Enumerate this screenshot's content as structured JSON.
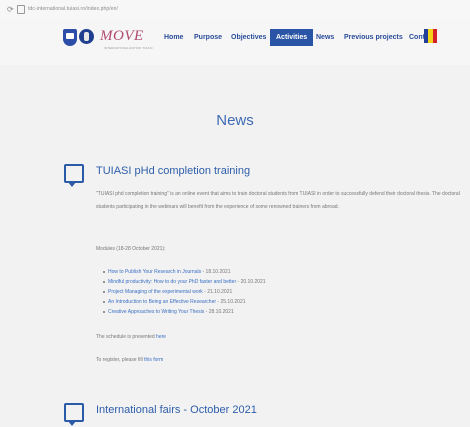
{
  "browser": {
    "url": "tdc-international.tuiasi.ro/index.php/en/"
  },
  "header": {
    "brand": "MOVE",
    "brand_sub": "INTERNATIONALIZATION TUIASI",
    "menu": [
      {
        "label": "Home",
        "active": false
      },
      {
        "label": "Purpose",
        "active": false
      },
      {
        "label": "Objectives",
        "active": false
      },
      {
        "label": "Activities",
        "active": true
      },
      {
        "label": "News",
        "active": false
      },
      {
        "label": "Previous projects",
        "active": false
      },
      {
        "label": "Contact",
        "active": false
      }
    ],
    "flag_colors": [
      "#1f3f9a",
      "#f2d318",
      "#d6202b"
    ]
  },
  "page": {
    "title": "News"
  },
  "sections": [
    {
      "title": "TUIASI pHd completion training",
      "body": "\"TUIASI phd completion training\" is an online event that aims to train doctoral students from TUIASI in order to successfully defend their doctoral thesis. The doctoral students participating in the webinars will benefit from the experience of some renowned trainers from abroad.",
      "modules_label": "Modules (18-28 October 2021):",
      "modules": [
        {
          "link": "How to Publish Your Research in Journals",
          "date": " - 18.10.2021"
        },
        {
          "link": "Mindful productivity: How to do your PhD faster and better",
          "date": " - 20.10.2021"
        },
        {
          "link": "Project Managing of the experimental work",
          "date": " - 21.10.2021"
        },
        {
          "link": "An Introduction to Being an Effective Researcher",
          "date": " - 25.10.2021"
        },
        {
          "link": "Creative Approaches to Writing Your Thesis",
          "date": " - 28.10.2021"
        }
      ],
      "schedule_text": "The schedule is presented ",
      "schedule_link": "here",
      "register_text": "To register, please fill ",
      "register_link": "this form"
    },
    {
      "title": "International fairs - October 2021"
    }
  ]
}
